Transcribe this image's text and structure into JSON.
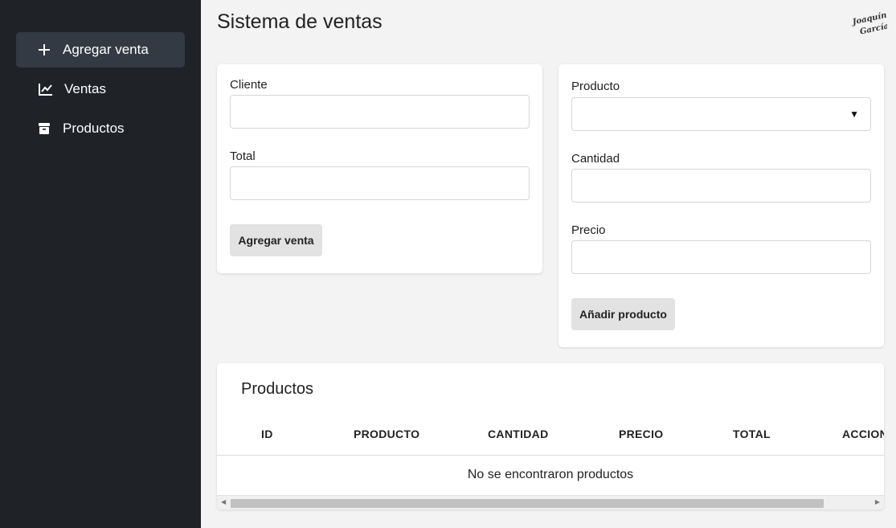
{
  "sidebar": {
    "items": [
      {
        "label": "Agregar venta",
        "icon": "plus-icon",
        "active": true
      },
      {
        "label": "Ventas",
        "icon": "chart-line-icon",
        "active": false
      },
      {
        "label": "Productos",
        "icon": "box-icon",
        "active": false
      }
    ]
  },
  "header": {
    "title": "Sistema de ventas",
    "logo_text": "Joaquín García"
  },
  "sale_form": {
    "cliente_label": "Cliente",
    "cliente_value": "",
    "total_label": "Total",
    "total_value": "",
    "submit_label": "Agregar venta"
  },
  "product_form": {
    "producto_label": "Producto",
    "producto_selected": "",
    "cantidad_label": "Cantidad",
    "cantidad_value": "",
    "precio_label": "Precio",
    "precio_value": "",
    "submit_label": "Añadir producto"
  },
  "products_table": {
    "title": "Productos",
    "columns": [
      "ID",
      "PRODUCTO",
      "CANTIDAD",
      "PRECIO",
      "TOTAL",
      "ACCIONES"
    ],
    "empty_message": "No se encontraron productos"
  },
  "colors": {
    "sidebar_bg": "#1f2227",
    "sidebar_active": "#343a44",
    "page_bg": "#f3f3f3",
    "button_bg": "#e2e2e2"
  }
}
